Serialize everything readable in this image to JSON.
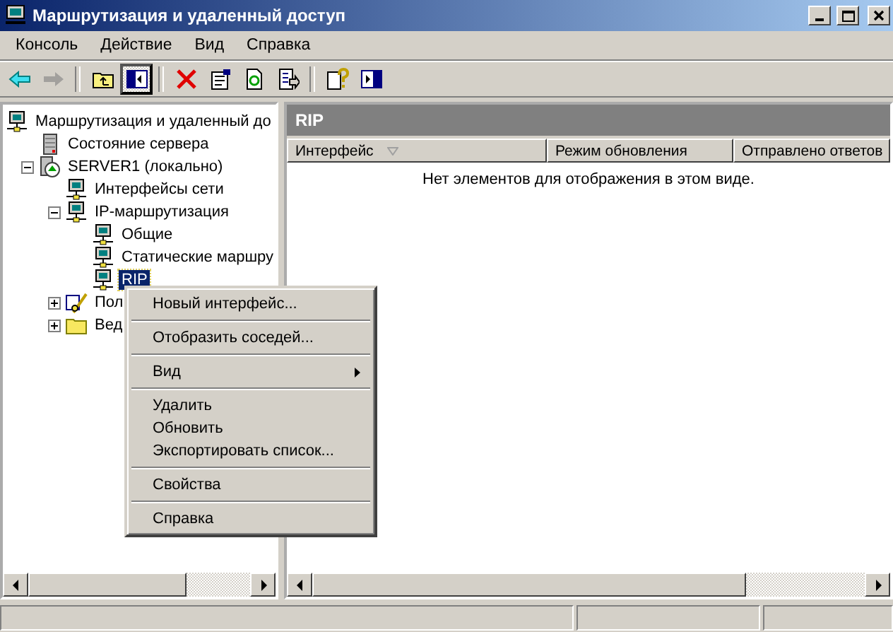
{
  "window": {
    "title": "Маршрутизация и удаленный доступ"
  },
  "menubar": [
    "Консоль",
    "Действие",
    "Вид",
    "Справка"
  ],
  "toolbar": [
    {
      "kind": "back",
      "disabled": false,
      "pressed": false
    },
    {
      "kind": "forward",
      "disabled": true,
      "pressed": false
    },
    {
      "kind": "up",
      "disabled": false,
      "pressed": false
    },
    {
      "kind": "tree",
      "disabled": false,
      "pressed": true
    },
    {
      "kind": "delete",
      "disabled": false,
      "pressed": false
    },
    {
      "kind": "properties",
      "disabled": false,
      "pressed": false
    },
    {
      "kind": "refresh",
      "disabled": false,
      "pressed": false
    },
    {
      "kind": "export",
      "disabled": false,
      "pressed": false
    },
    {
      "kind": "help",
      "disabled": false,
      "pressed": false
    },
    {
      "kind": "pane",
      "disabled": false,
      "pressed": false
    }
  ],
  "tree": [
    {
      "label": "Маршрутизация и удаленный до",
      "kind": "computer",
      "selected": false,
      "children": [
        {
          "label": "Состояние сервера",
          "kind": "server",
          "selected": false
        },
        {
          "label": "SERVER1 (локально)",
          "kind": "server-green",
          "selected": false,
          "expanded": true,
          "children": [
            {
              "label": "Интерфейсы сети",
              "kind": "computer",
              "selected": false
            },
            {
              "label": "IP-маршрутизация",
              "kind": "computer",
              "selected": false,
              "expanded": true,
              "children": [
                {
                  "label": "Общие",
                  "kind": "computer",
                  "selected": false
                },
                {
                  "label": "Статические маршру",
                  "kind": "computer",
                  "selected": false
                },
                {
                  "label": "RIP",
                  "kind": "computer",
                  "selected": true
                }
              ]
            },
            {
              "label": "Пол",
              "kind": "policy",
              "selected": false,
              "expanded": false
            },
            {
              "label": "Вед",
              "kind": "folder",
              "selected": false,
              "expanded": false
            }
          ]
        }
      ]
    }
  ],
  "details": {
    "title": "RIP",
    "columns": [
      {
        "label": "Интерфейс",
        "sorted": true
      },
      {
        "label": "Режим обновления",
        "sorted": false
      },
      {
        "label": "Отправлено ответов",
        "sorted": false
      }
    ],
    "empty_message": "Нет элементов для отображения в этом виде."
  },
  "context_menu": [
    [
      {
        "label": "Новый интерфейс...",
        "submenu": false
      }
    ],
    [
      {
        "label": "Отобразить соседей...",
        "submenu": false
      }
    ],
    [
      {
        "label": "Вид",
        "submenu": true
      }
    ],
    [
      {
        "label": "Удалить",
        "submenu": false
      },
      {
        "label": "Обновить",
        "submenu": false
      },
      {
        "label": "Экспортировать список...",
        "submenu": false
      }
    ],
    [
      {
        "label": "Свойства",
        "submenu": false
      }
    ],
    [
      {
        "label": "Справка",
        "submenu": false
      }
    ]
  ]
}
